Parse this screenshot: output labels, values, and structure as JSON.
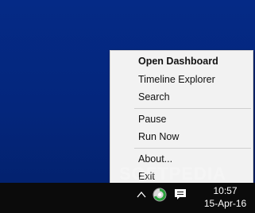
{
  "desktop": {
    "background_color": "#062a82"
  },
  "context_menu": {
    "items": [
      {
        "label": "Open Dashboard",
        "bold": true
      },
      {
        "label": "Timeline Explorer"
      },
      {
        "label": "Search"
      },
      {
        "label": "Pause"
      },
      {
        "label": "Run Now"
      },
      {
        "label": "About..."
      },
      {
        "label": "Exit"
      }
    ]
  },
  "taskbar": {
    "tray_icons": [
      "chevron-up-icon",
      "backup-app-icon",
      "action-center-icon"
    ],
    "clock": {
      "time": "10:57",
      "date": "15-Apr-16"
    }
  },
  "watermark": {
    "text": "SOFTPEDIA"
  },
  "colors": {
    "menu_bg": "#f2f2f2",
    "taskbar_bg": "#0b0b0b",
    "app_icon_green": "#2aa13b"
  }
}
